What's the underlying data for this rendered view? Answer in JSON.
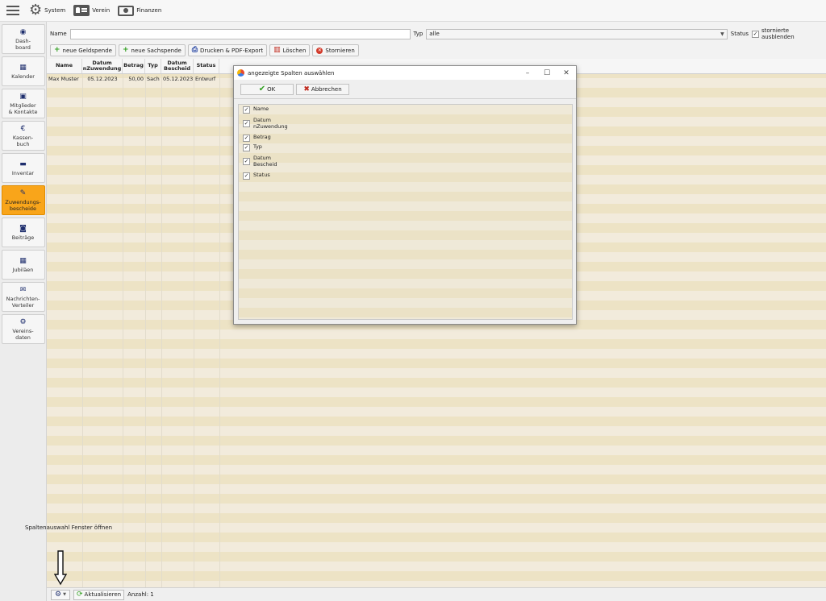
{
  "menubar": {
    "items": [
      {
        "label": "System",
        "icon": "gear-icon"
      },
      {
        "label": "Verein",
        "icon": "id-card-icon"
      },
      {
        "label": "Finanzen",
        "icon": "money-icon"
      }
    ]
  },
  "sidebar": {
    "items": [
      {
        "label": "Dash-\nboard",
        "icon": "dashboard-icon",
        "active": false
      },
      {
        "label": "Kalender",
        "icon": "calendar-icon",
        "active": false
      },
      {
        "label": "Mitglieder\n& Kontakte",
        "icon": "contacts-icon",
        "active": false
      },
      {
        "label": "Kassen-\nbuch",
        "icon": "euro-icon",
        "active": false
      },
      {
        "label": "Inventar",
        "icon": "archive-icon",
        "active": false
      },
      {
        "label": "Zuwendungs-\nbescheide",
        "icon": "certificate-icon",
        "active": true
      },
      {
        "label": "Beiträge",
        "icon": "money-icon",
        "active": false
      },
      {
        "label": "Jubiläen",
        "icon": "calendar-icon",
        "active": false
      },
      {
        "label": "Nachrichten-\nVerteiler",
        "icon": "mail-icon",
        "active": false
      },
      {
        "label": "Vereins-\ndaten",
        "icon": "gear-icon",
        "active": false
      }
    ]
  },
  "filters": {
    "name_label": "Name",
    "name_value": "",
    "type_label": "Typ",
    "type_value": "alle",
    "status_label": "Status",
    "hide_cancelled_label": "stornierte ausblenden",
    "hide_cancelled_checked": true
  },
  "toolbar": {
    "new_money": "neue Geldspende",
    "new_goods": "neue Sachspende",
    "print": "Drucken & PDF-Export",
    "delete": "Löschen",
    "cancel": "Stornieren"
  },
  "table": {
    "columns": [
      "Name",
      "Datum\nnZuwendung",
      "Betrag",
      "Typ",
      "Datum\nBescheid",
      "Status"
    ],
    "rows": [
      [
        "Max Muster",
        "05.12.2023",
        "50,00",
        "Sach",
        "05.12.2023",
        "Entwurf"
      ]
    ]
  },
  "statusbar": {
    "refresh": "Aktualisieren",
    "count": "Anzahl: 1"
  },
  "annotation": {
    "text": "Spaltenauswahl Fenster öffnen"
  },
  "dialog": {
    "title": "angezeigte Spalten auswählen",
    "ok": "OK",
    "cancel": "Abbrechen",
    "columns": [
      {
        "label": "Name",
        "checked": true
      },
      {
        "label": "Datum\nnZuwendung",
        "checked": true
      },
      {
        "label": "Betrag",
        "checked": true
      },
      {
        "label": "Typ",
        "checked": true
      },
      {
        "label": "Datum\nBescheid",
        "checked": true
      },
      {
        "label": "Status",
        "checked": true
      }
    ]
  },
  "colors": {
    "accent": "#f9a51a",
    "row_light": "#f2ebdc",
    "row_dark": "#ede3c5",
    "icon_blue": "#1f2f6e",
    "green": "#2f9e1e",
    "red": "#c0281c"
  }
}
